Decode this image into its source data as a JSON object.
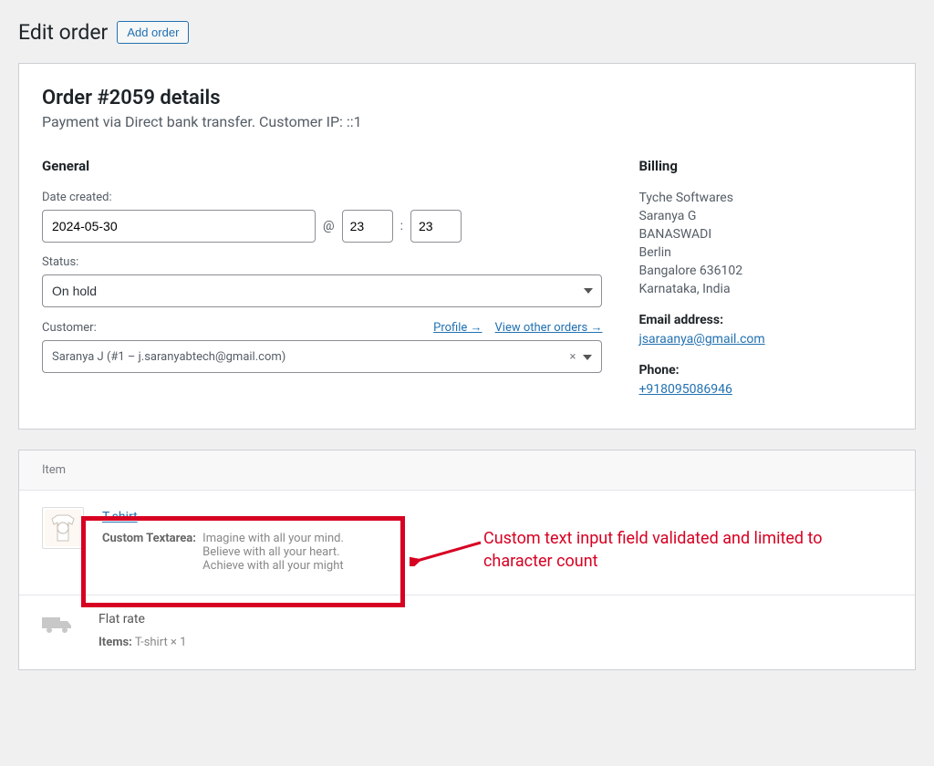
{
  "header": {
    "title": "Edit order",
    "add_order": "Add order"
  },
  "order_panel": {
    "title": "Order #2059 details",
    "subtitle": "Payment via Direct bank transfer. Customer IP: ::1",
    "general_heading": "General",
    "date_label": "Date created:",
    "date": "2024-05-30",
    "at": "@",
    "hour": "23",
    "colon": ":",
    "minute": "23",
    "status_label": "Status:",
    "status_value": "On hold",
    "customer_label": "Customer:",
    "profile_link": "Profile →",
    "other_orders_link": "View other orders →",
    "customer_value": "Saranya J (#1 – j.saranyabtech@gmail.com)"
  },
  "billing": {
    "heading": "Billing",
    "lines": [
      "Tyche Softwares",
      "Saranya G",
      "BANASWADI",
      "Berlin",
      "Bangalore 636102",
      "Karnataka, India"
    ],
    "email_label": "Email address:",
    "email": "jsaraanya@gmail.com",
    "phone_label": "Phone:",
    "phone": "+918095086946"
  },
  "items": {
    "header": "Item",
    "product_name": "T-shirt",
    "meta_label": "Custom Textarea:",
    "meta_value": "Imagine with all your mind.\nBelieve with all your heart.\nAchieve with all your might",
    "shipping_name": "Flat rate",
    "shipping_items_label": "Items:",
    "shipping_items_value": "T-shirt × 1"
  },
  "annotation": {
    "text": "Custom text input field validated and limited to character count"
  }
}
